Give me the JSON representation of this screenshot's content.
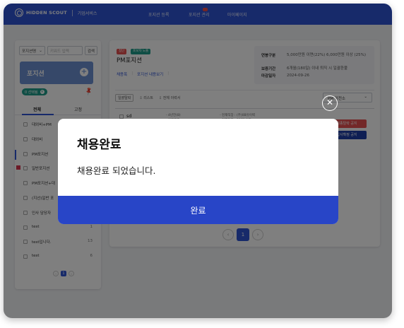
{
  "nav": {
    "logo_text": "HIDDEN SCOUT",
    "logo_sub": "기업서비스",
    "items": [
      {
        "label": "포지션 등록"
      },
      {
        "label": "포지션 관리"
      },
      {
        "label": "마이페이지"
      }
    ]
  },
  "left": {
    "select_label": "포지션명",
    "keyword_placeholder": "키워드 입력",
    "search_label": "검색",
    "header_title": "포지션",
    "selected_chip": "0 선택됨",
    "tabs": {
      "all": "전체",
      "fixed": "고정"
    },
    "items": [
      {
        "label": "대외비+PM",
        "count": ""
      },
      {
        "label": "대외비",
        "count": ""
      },
      {
        "label": "PM포지션",
        "count": ""
      },
      {
        "label": "일반포지션",
        "count": ""
      },
      {
        "label": "PM포지션+대",
        "count": ""
      },
      {
        "label": "(지선)일반 포",
        "count": ""
      },
      {
        "label": "인사 담당자",
        "count": ""
      },
      {
        "label": "test",
        "count": "1"
      },
      {
        "label": "test입니다.",
        "count": "13"
      },
      {
        "label": "test",
        "count": "6"
      }
    ],
    "page": "1"
  },
  "right": {
    "tag_status": "접단",
    "tag_exposure": "포보자 노출",
    "title": "PM포지션",
    "links": {
      "a": "채용폭",
      "b": "포지션 내용보기"
    },
    "info": {
      "salary_key": "연봉구분",
      "salary_val": "5,000만원 이면(22%) 6,000만원 이상 (25%)",
      "warranty_key": "보증기간",
      "warranty_val": "6개월(180일) 이내 퇴직 시 일괄환불",
      "deadline_key": "마감일자",
      "deadline_val": "2024-09-26"
    },
    "filters": {
      "chip": "일괄탈락",
      "list": "리스트",
      "print": "전체 이력서"
    },
    "dropdown": "PM 이전소",
    "row": {
      "name": "sd",
      "col1a": "- 4년전(8)",
      "col1b": "- 이전직장 :",
      "col2a": "- 현재직장 : (주)0B유이벽",
      "col2b": "- 현재연봉 : 3억원 이하"
    },
    "btn_red": "최종탈락 공지",
    "btn_blue": "입사확정 공지",
    "page": "1"
  },
  "modal": {
    "title": "채용완료",
    "message": "채용완료 되었습니다.",
    "confirm": "완료"
  },
  "colors": {
    "brand": "#2f55d4",
    "modal_button": "#2845c7"
  }
}
